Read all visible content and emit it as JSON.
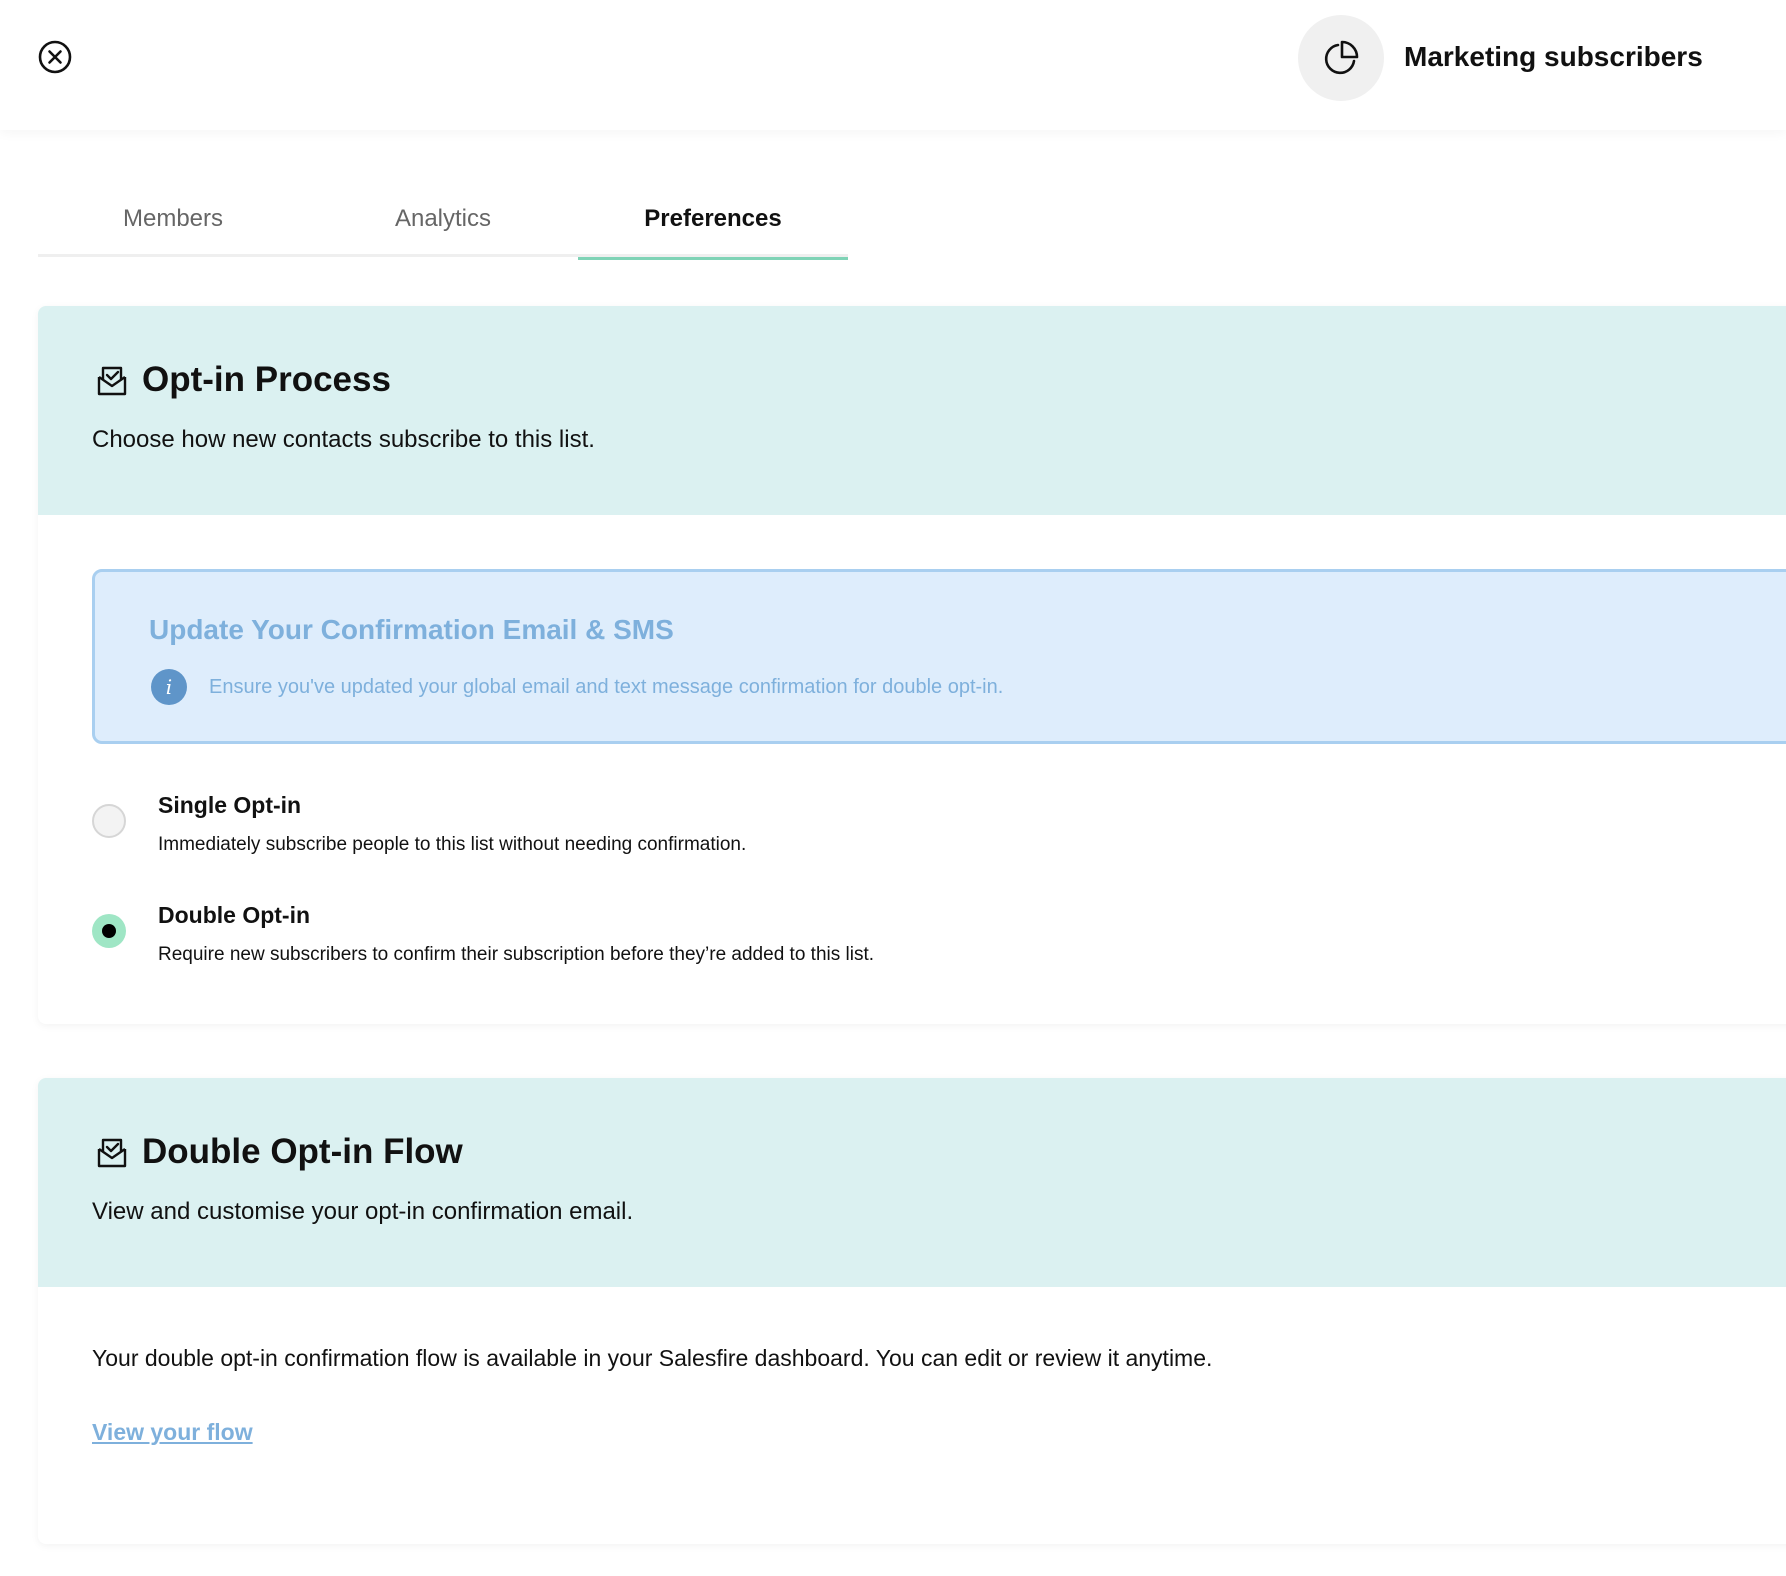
{
  "header": {
    "list_name": "Marketing subscribers",
    "close_icon": "close-circle-icon",
    "list_icon": "pie-chart-icon"
  },
  "tabs": [
    {
      "label": "Members",
      "active": false
    },
    {
      "label": "Analytics",
      "active": false
    },
    {
      "label": "Preferences",
      "active": true
    }
  ],
  "optin_section": {
    "icon": "mail-check-icon",
    "title": "Opt-in Process",
    "subtitle": "Choose how new contacts subscribe to this list.",
    "alert": {
      "title": "Update Your Confirmation Email & SMS",
      "icon": "info-icon",
      "icon_glyph": "i",
      "text": "Ensure you've updated your global email and text message confirmation for double opt-in."
    },
    "options": [
      {
        "title": "Single Opt-in",
        "description": "Immediately subscribe people to this list without needing confirmation.",
        "selected": false
      },
      {
        "title": "Double Opt-in",
        "description": "Require new subscribers to confirm their subscription before they’re added to this list.",
        "selected": true
      }
    ]
  },
  "flow_section": {
    "icon": "mail-check-icon",
    "title": "Double Opt-in Flow",
    "subtitle": "View and customise your opt-in confirmation email.",
    "body": "Your double opt-in confirmation flow is available in your Salesfire dashboard. You can edit or review it anytime.",
    "link_label": "View your flow"
  },
  "colors": {
    "accent_tab_underline": "#7fd3b6",
    "section_header_bg": "#dbf1f1",
    "alert_bg": "#deedfc",
    "alert_border": "#a9cff0",
    "alert_text": "#7eb0dc",
    "radio_selected": "#9fe6c5",
    "link": "#7eb0dc"
  }
}
